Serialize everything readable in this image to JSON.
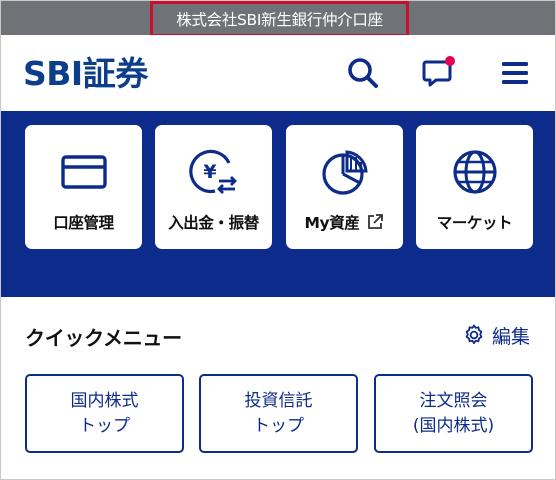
{
  "top_bar": {
    "intermediary_text": "株式会社SBI新生銀行仲介口座"
  },
  "header": {
    "logo_text": "SBI証券",
    "icons": [
      "search-icon",
      "chat-icon",
      "hamburger-menu-icon"
    ]
  },
  "tiles": [
    {
      "label": "口座管理",
      "icon": "card-icon"
    },
    {
      "label": "入出金・振替",
      "icon": "yen-transfer-icon"
    },
    {
      "label": "My資産",
      "icon": "pie-chart-icon",
      "suffix_icon": "external-link-icon"
    },
    {
      "label": "マーケット",
      "icon": "globe-icon"
    }
  ],
  "quick_menu": {
    "title": "クイックメニュー",
    "edit_label": "編集",
    "edit_icon": "gear-icon",
    "buttons": [
      {
        "line1": "国内株式",
        "line2": "トップ"
      },
      {
        "line1": "投資信託",
        "line2": "トップ"
      },
      {
        "line1": "注文照会",
        "line2": "(国内株式)"
      }
    ]
  },
  "colors": {
    "brand_navy": "#0c2b8a",
    "logo_blue": "#0c3e8a",
    "top_bar_grey": "#6f7277",
    "highlight_red": "#c8102e",
    "notify_pink": "#e6004d"
  }
}
